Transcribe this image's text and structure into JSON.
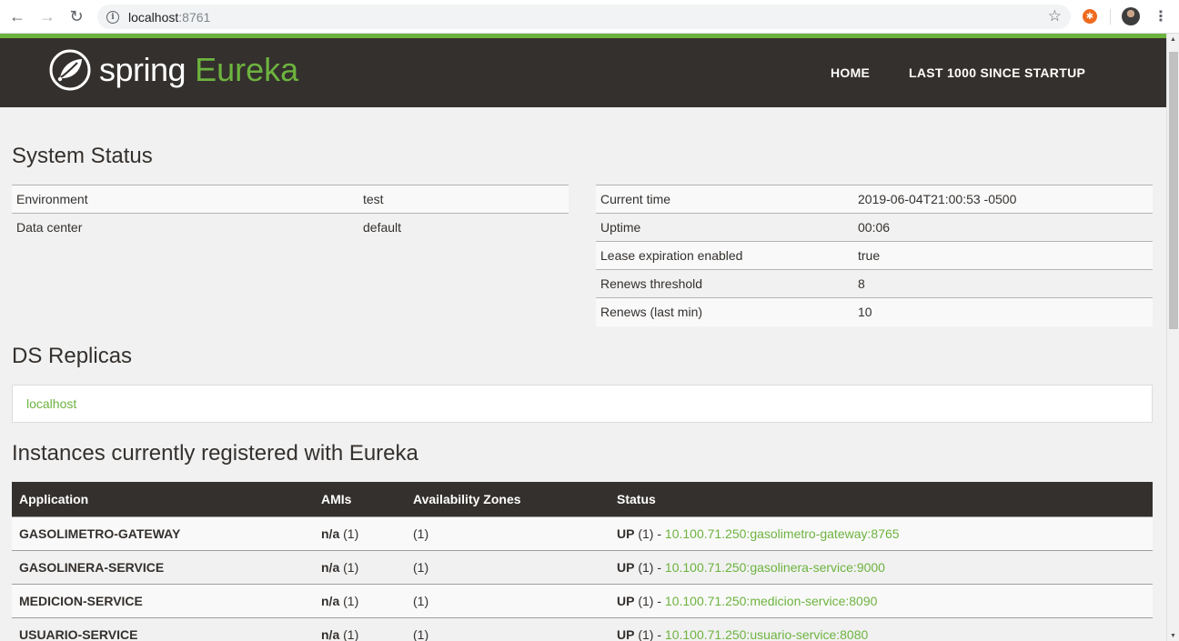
{
  "browser": {
    "url_host": "localhost",
    "url_port": ":8761",
    "back_glyph": "←",
    "forward_glyph": "→",
    "reload_glyph": "↻",
    "info_glyph": "i",
    "star_glyph": "☆",
    "menu_glyph": "⋮",
    "extension_glyph": "✱"
  },
  "brand": {
    "spring": "spring",
    "eureka": "Eureka",
    "brand_color": "#6db33f",
    "header_color": "#34302d"
  },
  "nav": {
    "home": "HOME",
    "last_1000": "LAST 1000 SINCE STARTUP"
  },
  "system_status": {
    "title": "System Status",
    "left": [
      {
        "label": "Environment",
        "value": "test"
      },
      {
        "label": "Data center",
        "value": "default"
      }
    ],
    "right": [
      {
        "label": "Current time",
        "value": "2019-06-04T21:00:53 -0500"
      },
      {
        "label": "Uptime",
        "value": "00:06"
      },
      {
        "label": "Lease expiration enabled",
        "value": "true"
      },
      {
        "label": "Renews threshold",
        "value": "8"
      },
      {
        "label": "Renews (last min)",
        "value": "10"
      }
    ]
  },
  "ds_replicas": {
    "title": "DS Replicas",
    "items": [
      "localhost"
    ]
  },
  "instances": {
    "title": "Instances currently registered with Eureka",
    "headers": [
      "Application",
      "AMIs",
      "Availability Zones",
      "Status"
    ],
    "rows": [
      {
        "app": "GASOLIMETRO-GATEWAY",
        "ami": "n/a",
        "ami_count": " (1)",
        "zones": "(1)",
        "status": "UP",
        "status_count": " (1) - ",
        "link": "10.100.71.250:gasolimetro-gateway:8765"
      },
      {
        "app": "GASOLINERA-SERVICE",
        "ami": "n/a",
        "ami_count": " (1)",
        "zones": "(1)",
        "status": "UP",
        "status_count": " (1) - ",
        "link": "10.100.71.250:gasolinera-service:9000"
      },
      {
        "app": "MEDICION-SERVICE",
        "ami": "n/a",
        "ami_count": " (1)",
        "zones": "(1)",
        "status": "UP",
        "status_count": " (1) - ",
        "link": "10.100.71.250:medicion-service:8090"
      },
      {
        "app": "USUARIO-SERVICE",
        "ami": "n/a",
        "ami_count": " (1)",
        "zones": "(1)",
        "status": "UP",
        "status_count": " (1) - ",
        "link": "10.100.71.250:usuario-service:8080"
      }
    ]
  }
}
